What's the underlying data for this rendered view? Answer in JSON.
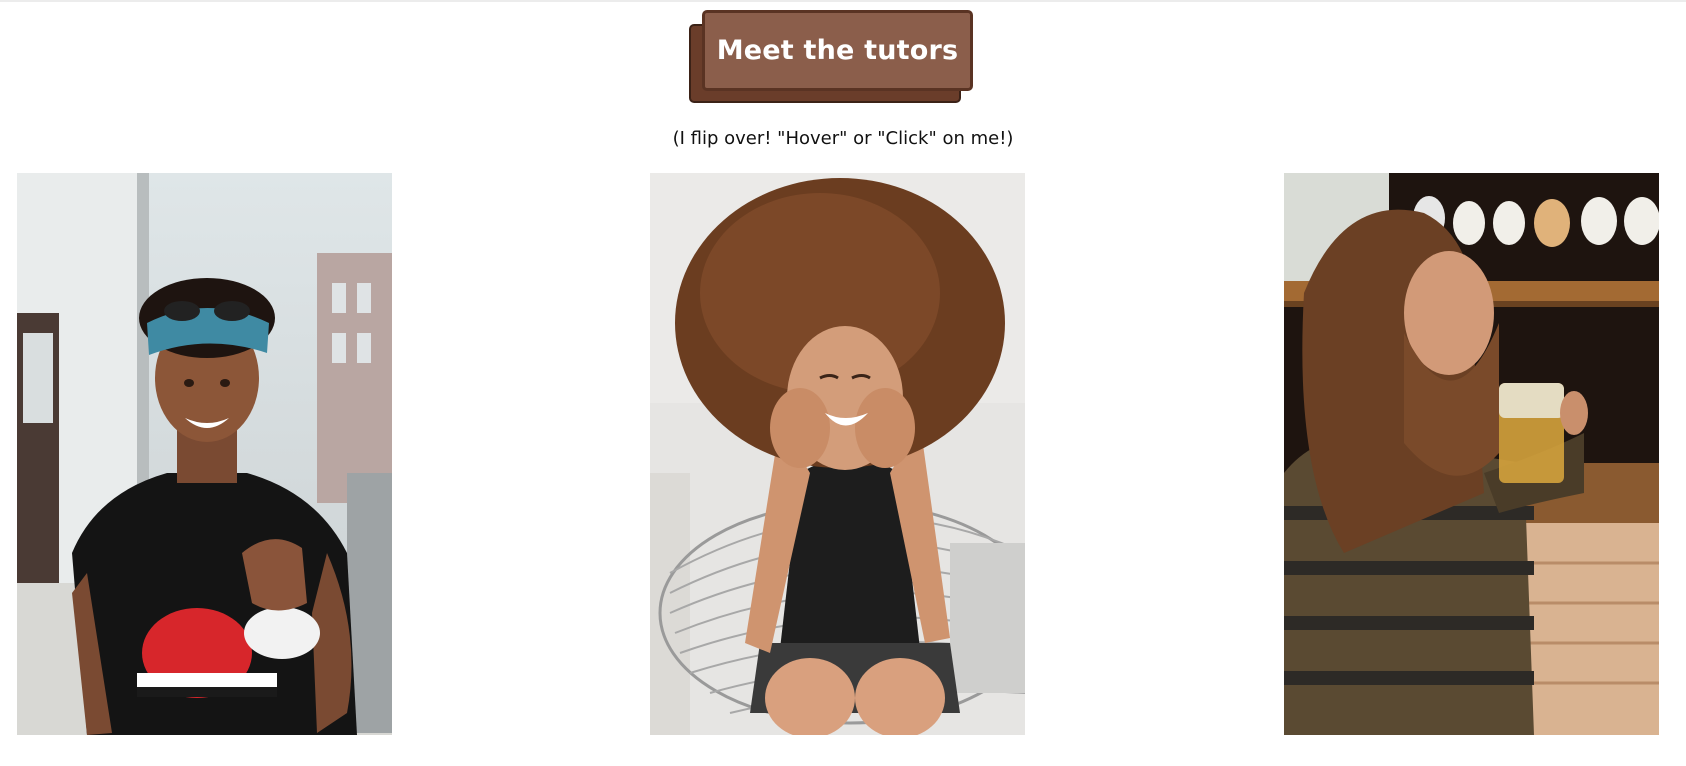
{
  "heading": {
    "label": "Meet the tutors"
  },
  "hint": {
    "text": "(I flip over! \"Hover\" or \"Click\" on me!)"
  },
  "tutors": [
    {
      "photo": "smiling man with bandana and sunglasses on a city street"
    },
    {
      "photo": "smiling woman with curly hair sitting in a wire chair"
    },
    {
      "photo": "long-haired bearded man drinking beer at a bar"
    }
  ],
  "colors": {
    "button_face": "#8b5e4b",
    "button_shadow": "#6a3d2a",
    "button_border": "#5a3323",
    "button_text": "#ffffff"
  }
}
